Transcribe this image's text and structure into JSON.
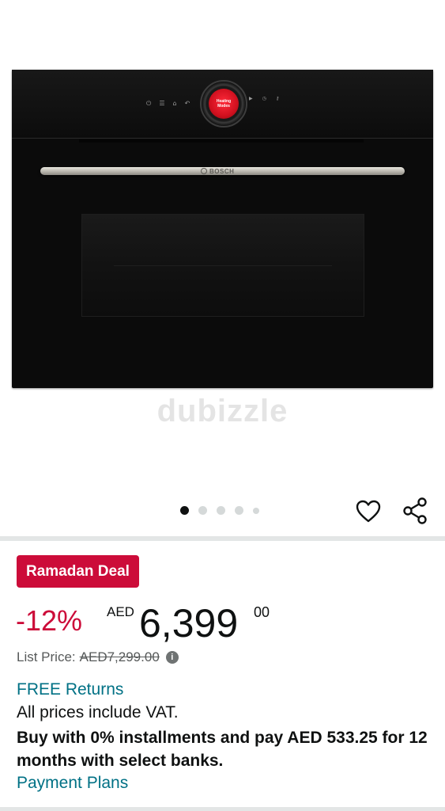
{
  "product_image": {
    "oven_display_text": "Heating Modes",
    "brand_text": "BOSCH",
    "watermark_text": "dubizzle",
    "active_image_index": 1,
    "image_count": 5
  },
  "actions": {
    "wishlist_icon": "heart-outline-icon",
    "share_icon": "share-icon"
  },
  "deal": {
    "badge_label": "Ramadan Deal",
    "badge_color": "#cc0c39"
  },
  "price": {
    "discount": "-12%",
    "currency": "AED",
    "whole": "6,399",
    "fraction": "00",
    "list_price_label": "List Price:",
    "list_price_value": "AED7,299.00",
    "info_glyph": "i"
  },
  "info": {
    "free_returns": "FREE Returns",
    "vat_note": "All prices include VAT.",
    "installments": "Buy with 0% installments and pay AED 533.25 for 12 months with select banks.",
    "payment_plans": "Payment Plans",
    "link_color": "#007185"
  }
}
